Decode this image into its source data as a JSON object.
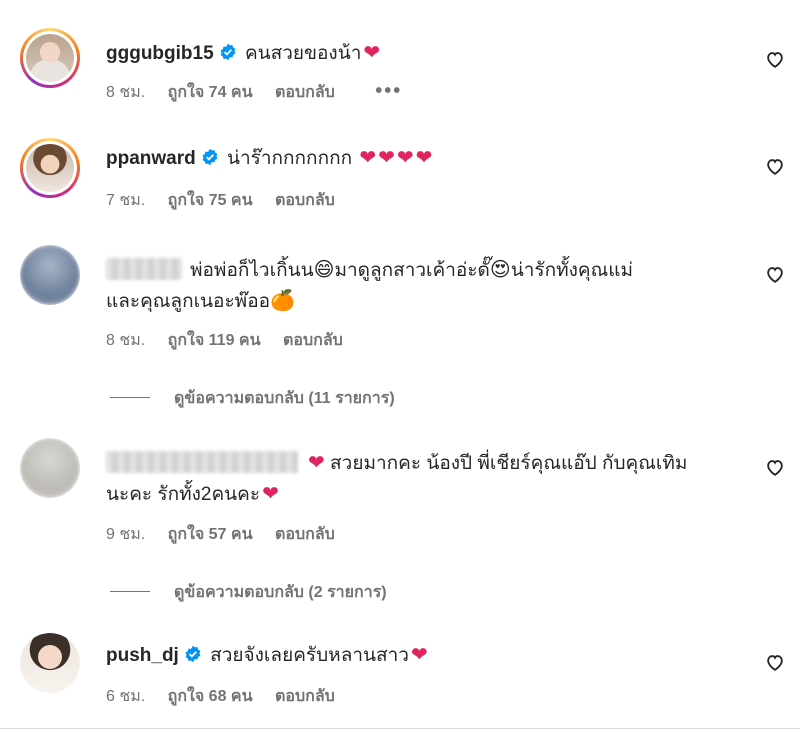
{
  "comments": [
    {
      "username": "gggubgib15",
      "verified": true,
      "text": "คนสวยของน้า",
      "time": "8 ชม.",
      "likes": "ถูกใจ 74 คน",
      "reply": "ตอบกลับ",
      "more": "•••"
    },
    {
      "username": "ppanward",
      "verified": true,
      "text": "น่าร๊ากกกกกกก",
      "time": "7 ชม.",
      "likes": "ถูกใจ 75 คน",
      "reply": "ตอบกลับ"
    },
    {
      "username": "",
      "verified": false,
      "text_parts": [
        "พ่อพ่อก็ไวเกิ้นน",
        "มาดูลูกสาวเค้าอ่ะดั๊",
        "น่ารักทั้งคุณแม่",
        "และคุณลูกเนอะพ๊ออ"
      ],
      "emojis": [
        "😄",
        "😍",
        "🍊"
      ],
      "time": "8 ชม.",
      "likes": "ถูกใจ 119 คน",
      "reply": "ตอบกลับ",
      "view_replies": "ดูข้อความตอบกลับ (11 รายการ)"
    },
    {
      "username": "",
      "verified": false,
      "text_line1": "สวยมากคะ น้องปี พี่เชียร์คุณแอ๊ป กับคุณเทิม",
      "text_line2": "นะคะ รักทั้ง2คนคะ",
      "time": "9 ชม.",
      "likes": "ถูกใจ 57 คน",
      "reply": "ตอบกลับ",
      "view_replies": "ดูข้อความตอบกลับ (2 รายการ)"
    },
    {
      "username": "push_dj",
      "verified": true,
      "text": "สวยจังเลยครับหลานสาว",
      "time": "6 ชม.",
      "likes": "ถูกใจ 68 คน",
      "reply": "ตอบกลับ"
    }
  ],
  "icons": {
    "verified": "verified-badge-icon",
    "like": "heart-outline-icon",
    "heart_emoji": "❤️"
  },
  "colors": {
    "verified": "#0095f6",
    "heart": "#e0245e",
    "text": "#262626",
    "meta": "#737373"
  }
}
